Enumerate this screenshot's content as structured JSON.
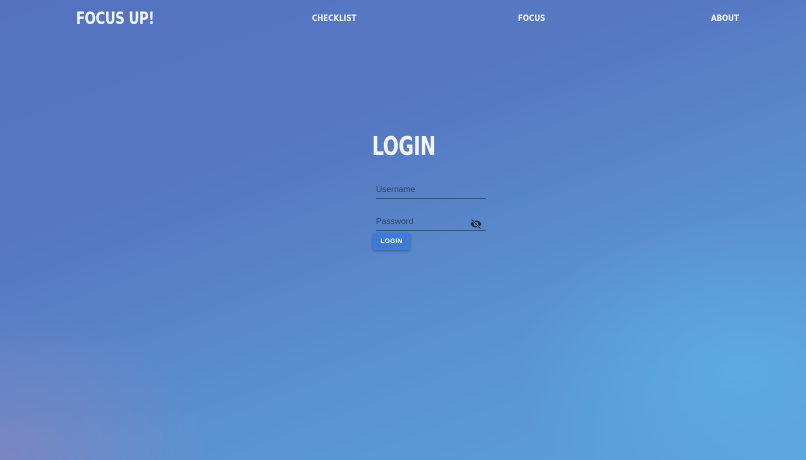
{
  "navbar": {
    "brand": "FOCUS UP!",
    "links": [
      {
        "label": "CHECKLIST"
      },
      {
        "label": "FOCUS"
      },
      {
        "label": "ABOUT"
      }
    ]
  },
  "login": {
    "title": "LOGIN",
    "username": {
      "placeholder": "Username",
      "value": ""
    },
    "password": {
      "placeholder": "Password",
      "value": "",
      "toggle_icon": "eye-off-icon"
    },
    "button_label": "LOGIN"
  },
  "colors": {
    "accent": "#3f7ad6",
    "text_light": "#f3f4fa",
    "background_top": "#5472c0",
    "background_bottom": "#5aa2dc"
  }
}
